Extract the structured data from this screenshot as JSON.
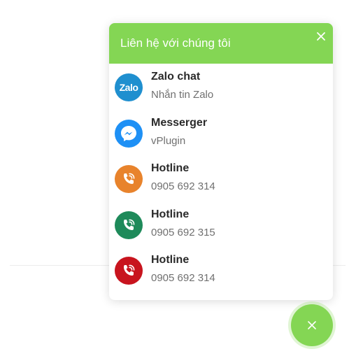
{
  "panel": {
    "title": "Liên hệ với chúng tôi",
    "header_color": "#84d654"
  },
  "contacts": [
    {
      "name": "Zalo chat",
      "sub": "Nhắn tin Zalo",
      "icon": "zalo-icon",
      "color": "#1f8fcf",
      "icon_text": "Zalo"
    },
    {
      "name": "Messerger",
      "sub": "vPlugin",
      "icon": "messenger-icon",
      "color": "#1e90f5"
    },
    {
      "name": "Hotline",
      "sub": "0905 692 314",
      "icon": "phone-icon",
      "color": "#e8832c"
    },
    {
      "name": "Hotline",
      "sub": "0905 692 315",
      "icon": "phone-icon",
      "color": "#1e8a5a"
    },
    {
      "name": "Hotline",
      "sub": "0905 692 314",
      "icon": "phone-icon",
      "color": "#c8141e"
    }
  ],
  "fab": {
    "icon": "close-icon",
    "color": "#84d654"
  }
}
